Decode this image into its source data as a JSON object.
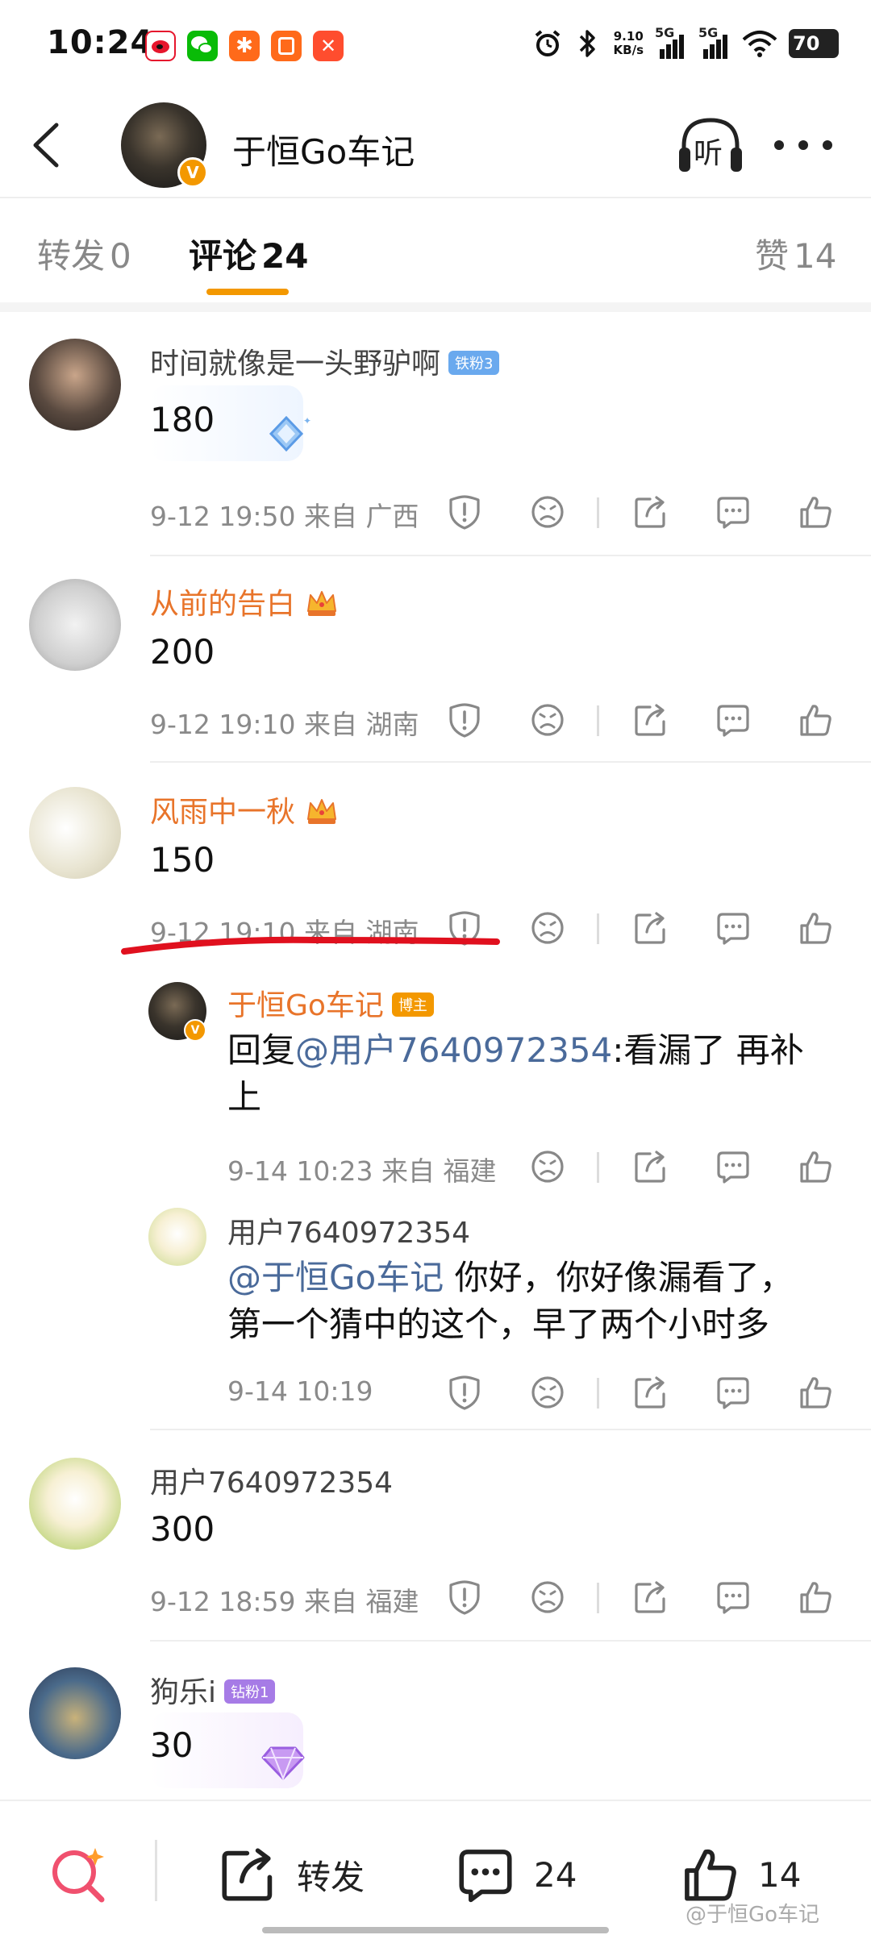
{
  "status_bar": {
    "time": "10:24",
    "network_speed_value": "9.10",
    "network_speed_unit": "KB/s",
    "signal1": "5G",
    "signal2": "5G",
    "battery": "70",
    "notification_icons": [
      "weibo-icon",
      "wechat-icon",
      "app-orange-icon",
      "app-green-icon",
      "app-red-icon"
    ]
  },
  "header": {
    "title": "于恒Go车记",
    "listen_label": "听",
    "verify_mark": "V"
  },
  "tabs": [
    {
      "label": "转发",
      "count": "0"
    },
    {
      "label": "评论",
      "count": "24",
      "active": true
    },
    {
      "label": "赞",
      "count": "14"
    }
  ],
  "comments": [
    {
      "username": "时间就像是一头野驴啊",
      "badge": "铁粉3",
      "text": "180",
      "meta": "9-12 19:50 来自 广西"
    },
    {
      "username": "从前的告白",
      "text": "200",
      "meta": "9-12 19:10 来自 湖南"
    },
    {
      "username": "风雨中一秋",
      "text": "150",
      "meta": "9-12 19:10 来自 湖南",
      "replies": [
        {
          "username": "于恒Go车记",
          "badge": "博主",
          "text_prefix": "回复",
          "mention": "@用户7640972354",
          "text_line1_rest": ":看漏了 再补",
          "text_line2": "上",
          "meta": "9-14 10:23 来自 福建"
        },
        {
          "username": "用户7640972354",
          "mention": "@于恒Go车记",
          "text_line1_rest": " 你好，你好像漏看了，",
          "text_line2": "第一个猜中的这个，早了两个小时多",
          "meta": "9-14 10:19"
        }
      ]
    },
    {
      "username": "用户7640972354",
      "text": "300",
      "meta": "9-12 18:59 来自 福建"
    },
    {
      "username": "狗乐i",
      "badge": "钻粉1",
      "text": "30"
    }
  ],
  "bottom_bar": {
    "repost_label": "转发",
    "comment_count": "24",
    "like_count": "14",
    "watermark": "@于恒Go车记"
  },
  "colors": {
    "accent": "#f39800",
    "username_orange": "#e8742a",
    "mention": "#4a6a9a",
    "meta_gray": "#8a8a8a",
    "annotation_red": "#e0101e"
  }
}
